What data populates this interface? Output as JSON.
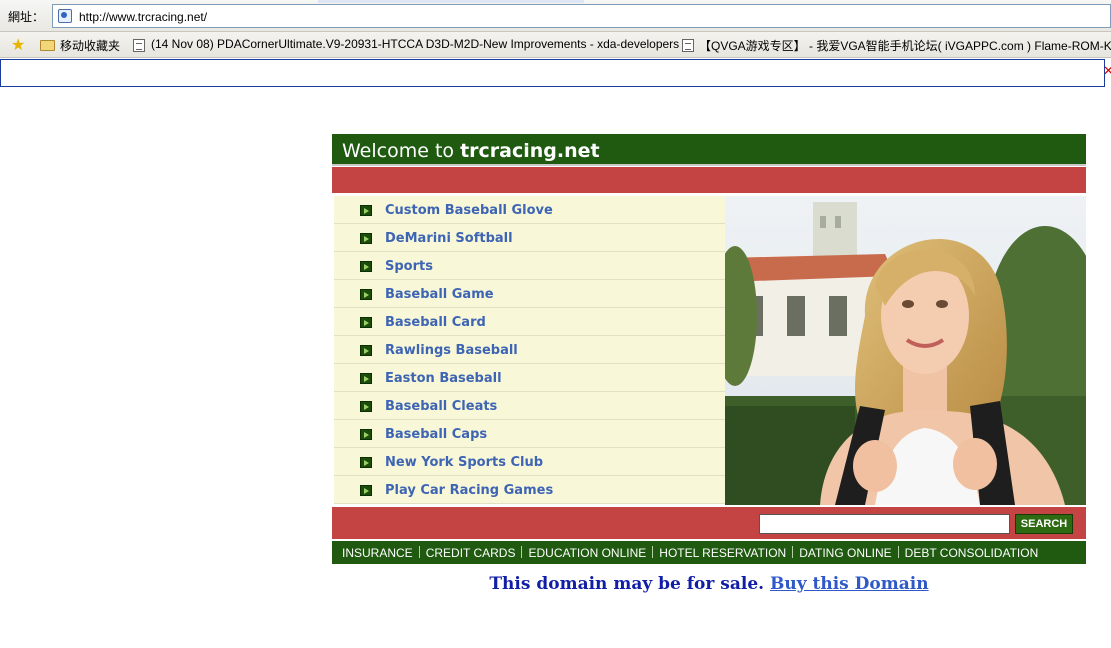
{
  "browser": {
    "address_label": "網址：",
    "url": "http://www.trcracing.net/",
    "bookmarks": [
      "移动收藏夹",
      "(14 Nov 08) PDACornerUltimate.V9-20931-HTCCA D3D-M2D-New Improvements - xda-developers",
      "【QVGA游戏专区】 - 我爱VGA智能手机论坛( iVGAPPC.com ) Flame-ROM-Kitchen"
    ],
    "close_glyph": "✕"
  },
  "site": {
    "welcome_prefix": "Welcome to ",
    "domain": "trcracing.net",
    "links": [
      "Custom Baseball Glove",
      "DeMarini Softball",
      "Sports",
      "Baseball Game",
      "Baseball Card",
      "Rawlings Baseball",
      "Easton Baseball",
      "Baseball Cleats",
      "Baseball Caps",
      "New York Sports Club",
      "Play Car Racing Games"
    ],
    "search_button": "SEARCH",
    "nav": [
      "INSURANCE",
      "CREDIT CARDS",
      "EDUCATION ONLINE",
      "HOTEL RESERVATION",
      "DATING ONLINE",
      "DEBT CONSOLIDATION"
    ],
    "sale_text": "This domain may be for sale.",
    "buy_link": "Buy this Domain"
  },
  "colors": {
    "green": "#1f5a10",
    "red": "#c44343",
    "link": "#3e64b4",
    "sale": "#101ea8"
  }
}
